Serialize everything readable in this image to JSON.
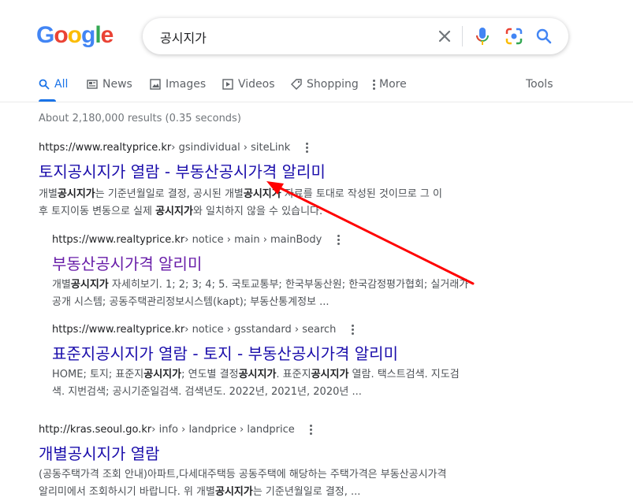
{
  "logo": {
    "letters": [
      "G",
      "o",
      "o",
      "g",
      "l",
      "e"
    ],
    "colors": [
      "#4285f4",
      "#ea4335",
      "#fbbc05",
      "#4285f4",
      "#34a853",
      "#ea4335"
    ]
  },
  "search": {
    "query": "공시지가",
    "clear_icon": "close-icon",
    "voice_icon": "microphone-icon",
    "lens_icon": "camera-icon",
    "search_icon": "search-icon"
  },
  "tabs": [
    {
      "label": "All",
      "icon": "search-icon",
      "active": true
    },
    {
      "label": "News",
      "icon": "news-icon"
    },
    {
      "label": "Images",
      "icon": "image-icon"
    },
    {
      "label": "Videos",
      "icon": "play-icon"
    },
    {
      "label": "Shopping",
      "icon": "tag-icon"
    },
    {
      "label": "More",
      "icon": "more-vertical-icon"
    }
  ],
  "tools_label": "Tools",
  "stats": "About 2,180,000 results (0.35 seconds)",
  "results": [
    {
      "site": "https://www.realtyprice.kr",
      "path": " › gsindividual › siteLink",
      "title": "토지공시지가 열람 - 부동산공시가격 알리미",
      "snippet": [
        [
          "개별",
          ""
        ],
        [
          "공시지가",
          "b"
        ],
        [
          "는 기준년월일로 결정, 공시된 개별",
          ""
        ],
        [
          "공시지가",
          "b"
        ],
        [
          " 자료를 토대로 작성된 것이므로 그 이",
          ""
        ],
        [
          "\n",
          ""
        ],
        [
          "후 토지이동 변동으로 실제 ",
          ""
        ],
        [
          "공시지가",
          "b"
        ],
        [
          "와 일치하지 않을 수 있습니다.",
          ""
        ]
      ]
    },
    {
      "site": "https://www.realtyprice.kr",
      "path": " › notice › main › mainBody",
      "title": "부동산공시가격 알리미",
      "snippet": [
        [
          "개별",
          ""
        ],
        [
          "공시지가",
          "b"
        ],
        [
          " 자세히보기. 1; 2; 3; 4; 5. 국토교통부; 한국부동산원; 한국감정평가협회; 실거래가",
          ""
        ],
        [
          "\n",
          ""
        ],
        [
          "공개 시스템; 공동주택관리정보시스템(kapt); 부동산통계정보 ...",
          ""
        ]
      ]
    },
    {
      "site": "https://www.realtyprice.kr",
      "path": " › notice › gsstandard › search",
      "title": "표준지공시지가 열람 - 토지 - 부동산공시가격 알리미",
      "snippet": [
        [
          "HOME; 토지; 표준지",
          ""
        ],
        [
          "공시지가",
          "b"
        ],
        [
          "; 연도별 결정",
          ""
        ],
        [
          "공시지가",
          "b"
        ],
        [
          ". 표준지",
          ""
        ],
        [
          "공시지가",
          "b"
        ],
        [
          " 열람. 택스트검색. 지도검",
          ""
        ],
        [
          "\n",
          ""
        ],
        [
          "색. 지번검색; 공시기준일검색. 검색년도. 2022년, 2021년, 2020년 ...",
          ""
        ]
      ]
    },
    {
      "site": "http://kras.seoul.go.kr",
      "path": " › info › landprice › landprice",
      "title": "개별공시지가 열람",
      "snippet": [
        [
          "(공동주택가격 조회 안내)아파트,다세대주택등 공동주택에 해당하는 주택가격은 부동산공시가격",
          ""
        ],
        [
          "\n",
          ""
        ],
        [
          "알리미에서 조회하시기 바랍니다. 위 개별",
          ""
        ],
        [
          "공시지가",
          "b"
        ],
        [
          "는 기준년월일로 결정, ...",
          ""
        ]
      ]
    }
  ],
  "annotation": {
    "color": "#ff0000"
  }
}
